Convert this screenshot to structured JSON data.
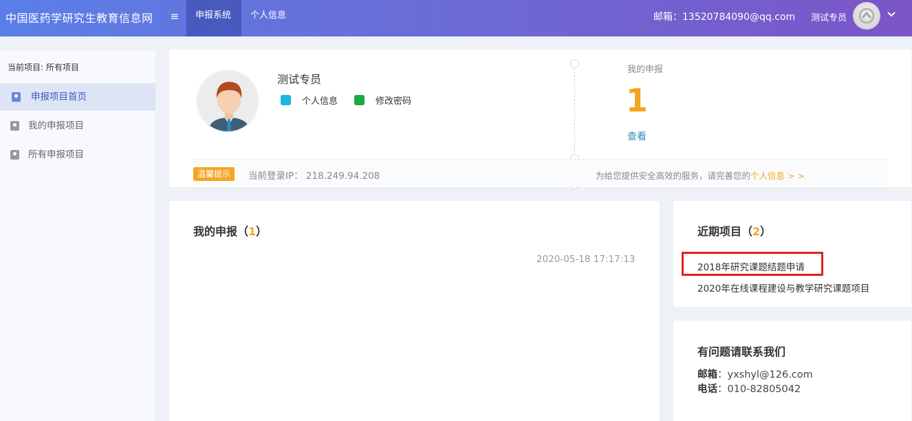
{
  "header": {
    "brand": "中国医药学研究生教育信息网",
    "tabs": [
      {
        "label": "申报系统"
      },
      {
        "label": "个人信息"
      }
    ],
    "email": "邮箱：13520784090@qq.com",
    "user_name": "测试专员"
  },
  "sidebar": {
    "current_project": "当前项目: 所有项目",
    "items": [
      {
        "label": "申报项目首页"
      },
      {
        "label": "我的申报项目"
      },
      {
        "label": "所有申报项目"
      }
    ]
  },
  "profile": {
    "name": "测试专员",
    "link_personal": "个人信息",
    "link_password": "修改密码",
    "my_apply_label": "我的申报",
    "my_apply_count": "1",
    "view_label": "查看",
    "tip_badge": "温馨提示",
    "ip_text": "当前登录IP： 218.249.94.208",
    "info_text": "为给您提供安全高效的服务，请完善您的",
    "info_link": "个人信息 > >"
  },
  "my_apply": {
    "title": "我的申报（",
    "count": "1",
    "title_end": "）",
    "date": "2020-05-18 17:17:13"
  },
  "recent": {
    "title": "近期项目（",
    "count": "2",
    "title_end": "）",
    "items": [
      {
        "label": "2018年研究课题结题申请"
      },
      {
        "label": "2020年在线课程建设与教学研究课题项目"
      }
    ]
  },
  "contact": {
    "title": "有问题请联系我们",
    "email_label": "邮箱",
    "email_value": "：yxshyl@126.com",
    "phone_label": "电话",
    "phone_value": "：010-82805042"
  },
  "colors": {
    "accent": "#f5a320",
    "link": "#2a8fbd",
    "highlight": "#e02020"
  }
}
